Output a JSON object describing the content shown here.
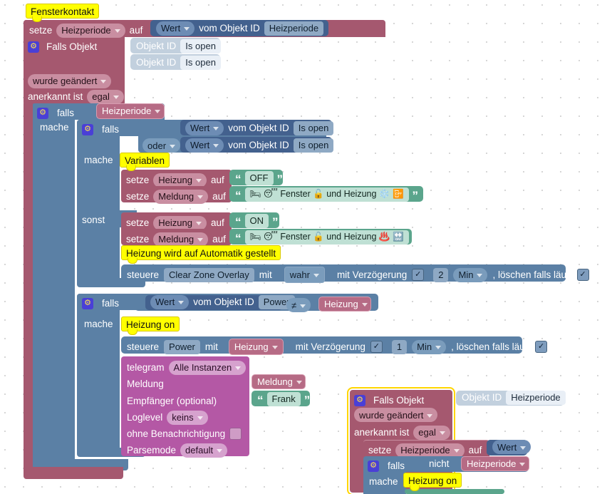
{
  "app": {
    "type": "blockly-visual-script-editor",
    "language": "de",
    "background": "#ffffff",
    "grid_dot_color": "#c9c9c9"
  },
  "colors": {
    "rose": "#a5586f",
    "blue": "#5b80a5",
    "dark_blue": "#43618e",
    "light_blue": "#c2d0de",
    "green": "#5ba58c",
    "purple": "#b458a5",
    "variable_pink": "#b66b85",
    "note_yellow": "#ffff00",
    "selection_outline": "#ffd500"
  },
  "script1": {
    "comment": "Fensterkontakt",
    "set_row": {
      "set_label": "setze",
      "variable": "Heizperiode",
      "to_label": "auf",
      "value_block": {
        "field": "Wert",
        "label": "vom Objekt ID",
        "object_id": "Heizperiode"
      }
    },
    "trigger": {
      "title": "Falls Objekt",
      "gear_icon": "gear-icon",
      "object_rows": [
        {
          "label": "Objekt ID",
          "value": "Is open"
        },
        {
          "label": "Objekt ID",
          "value": "Is open"
        }
      ],
      "changed_dropdown": "wurde geändert",
      "ack_label": "anerkannt ist",
      "ack_value": "egal"
    },
    "if_outer": {
      "if_label": "falls",
      "condition_variable": "Heizperiode",
      "do_label": "mache"
    },
    "if_inner": {
      "if_label": "falls",
      "do_label": "mache",
      "else_label": "sonst",
      "cond_a": {
        "field": "Wert",
        "label": "vom Objekt ID",
        "object_id": "Is open"
      },
      "or_label": "oder",
      "cond_b": {
        "field": "Wert",
        "label": "vom Objekt ID",
        "object_id": "Is open"
      }
    },
    "do_branch": {
      "note": "Variablen",
      "statements": [
        {
          "set_label": "setze",
          "variable": "Heizung",
          "to_label": "auf",
          "text": "OFF"
        },
        {
          "set_label": "setze",
          "variable": "Meldung",
          "to_label": "auf",
          "text": "🛏 😴 Fenster 🔓 und Heizung ❄️ 📴"
        }
      ]
    },
    "else_branch": {
      "statements": [
        {
          "set_label": "setze",
          "variable": "Heizung",
          "to_label": "auf",
          "text": "ON"
        },
        {
          "set_label": "setze",
          "variable": "Meldung",
          "to_label": "auf",
          "text": "🛏 😴 Fenster 🔓 und Heizung ♨️ 🔛"
        }
      ],
      "note": "Heizung wird auf Automatik gestellt",
      "control": {
        "control_label": "steuere",
        "object_id": "Clear Zone Overlay",
        "with_label": "mit",
        "value": "wahr",
        "delay_label": "mit Verzögerung",
        "delay_checked": "✓",
        "delay_amount": "2",
        "delay_unit": "Min",
        "clear_label": ", löschen falls läuft",
        "clear_checked": "✓"
      }
    },
    "if_power": {
      "if_label": "falls",
      "do_label": "mache",
      "condition": {
        "field": "Wert",
        "label": "vom Objekt ID",
        "object_id": "Power",
        "operator": "≠",
        "compare_variable": "Heizung"
      },
      "note": "Heizung on",
      "control": {
        "control_label": "steuere",
        "object_id": "Power",
        "with_label": "mit",
        "value_variable": "Heizung",
        "delay_label": "mit Verzögerung",
        "delay_checked": "✓",
        "delay_amount": "1",
        "delay_unit": "Min",
        "clear_label": ", löschen falls läuft",
        "clear_checked": "✓"
      },
      "telegram": {
        "title": "telegram",
        "instance": "Alle Instanzen",
        "message_label": "Meldung",
        "message_variable": "Meldung",
        "recipient_label": "Empfänger (optional)",
        "recipient_text": "Frank",
        "loglevel_label": "Loglevel",
        "loglevel_value": "keins",
        "silent_label": "ohne Benachrichtigung",
        "silent_checked": "",
        "parsemode_label": "Parsemode",
        "parsemode_value": "default"
      }
    }
  },
  "script2": {
    "selected": true,
    "trigger": {
      "title": "Falls Objekt",
      "gear_icon": "gear-icon",
      "object_row": {
        "label": "Objekt ID",
        "value": "Heizperiode"
      },
      "changed_dropdown": "wurde geändert",
      "ack_label": "anerkannt ist",
      "ack_value": "egal"
    },
    "set_row": {
      "set_label": "setze",
      "variable": "Heizperiode",
      "to_label": "auf",
      "value": "Wert"
    },
    "if_block": {
      "if_label": "falls",
      "not_label": "nicht",
      "condition_variable": "Heizperiode",
      "do_label": "mache",
      "note": "Heizung on"
    }
  }
}
